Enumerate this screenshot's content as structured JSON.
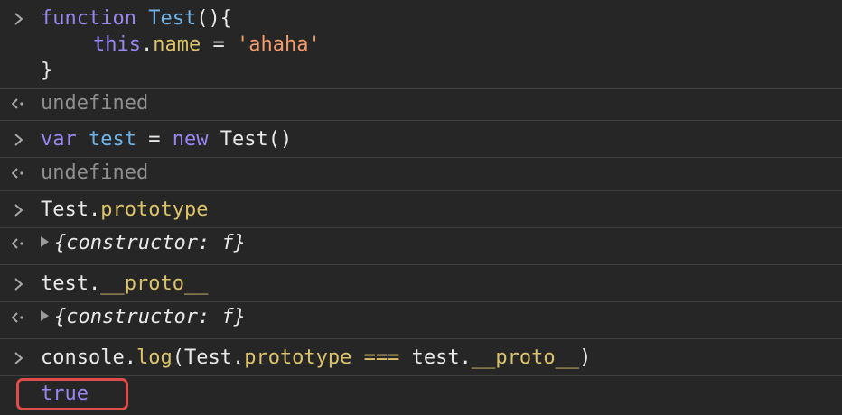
{
  "console": {
    "entries": [
      {
        "type": "input",
        "lines": [
          {
            "tokens": [
              {
                "t": "function",
                "c": "kw"
              },
              {
                "t": " ",
                "c": "plain"
              },
              {
                "t": "Test",
                "c": "fn"
              },
              {
                "t": "(){",
                "c": "plain"
              }
            ]
          },
          {
            "tokens": [
              {
                "t": "this",
                "c": "kw"
              },
              {
                "t": ".",
                "c": "plain"
              },
              {
                "t": "name",
                "c": "prop"
              },
              {
                "t": " = ",
                "c": "plain"
              },
              {
                "t": "'ahaha'",
                "c": "str"
              }
            ]
          },
          {
            "tokens": [
              {
                "t": "}",
                "c": "plain"
              }
            ]
          }
        ]
      },
      {
        "type": "output",
        "text": "undefined"
      },
      {
        "type": "input",
        "tokens": [
          {
            "t": "var",
            "c": "kw"
          },
          {
            "t": " ",
            "c": "plain"
          },
          {
            "t": "test",
            "c": "fn"
          },
          {
            "t": " = ",
            "c": "plain"
          },
          {
            "t": "new",
            "c": "kw"
          },
          {
            "t": " Test()",
            "c": "plain"
          }
        ]
      },
      {
        "type": "output",
        "text": "undefined"
      },
      {
        "type": "input",
        "tokens": [
          {
            "t": "Test.",
            "c": "plain"
          },
          {
            "t": "prototype",
            "c": "prop"
          }
        ]
      },
      {
        "type": "output_object",
        "text": "{constructor: f}"
      },
      {
        "type": "input",
        "tokens": [
          {
            "t": "test.",
            "c": "plain"
          },
          {
            "t": "__proto__",
            "c": "prop"
          }
        ]
      },
      {
        "type": "output_object",
        "text": "{constructor: f}"
      },
      {
        "type": "input",
        "tokens": [
          {
            "t": "console.",
            "c": "plain"
          },
          {
            "t": "log",
            "c": "prop"
          },
          {
            "t": "(Test.",
            "c": "plain"
          },
          {
            "t": "prototype",
            "c": "prop"
          },
          {
            "t": " ",
            "c": "plain"
          },
          {
            "t": "===",
            "c": "prop"
          },
          {
            "t": " test.",
            "c": "plain"
          },
          {
            "t": "__proto__",
            "c": "prop"
          },
          {
            "t": ")",
            "c": "plain"
          }
        ]
      },
      {
        "type": "log",
        "text": "true"
      }
    ]
  },
  "icons": {
    "input_prompt": "chevron-right-icon",
    "output_prompt": "return-arrow-icon",
    "expand": "expand-triangle-icon"
  },
  "colors": {
    "background": "#262626",
    "keyword": "#9a86f0",
    "function_name": "#6fb3e8",
    "property": "#dcc36a",
    "string": "#f39b6a",
    "undefined": "#8f8f8f",
    "highlight": "#e04b4b"
  }
}
